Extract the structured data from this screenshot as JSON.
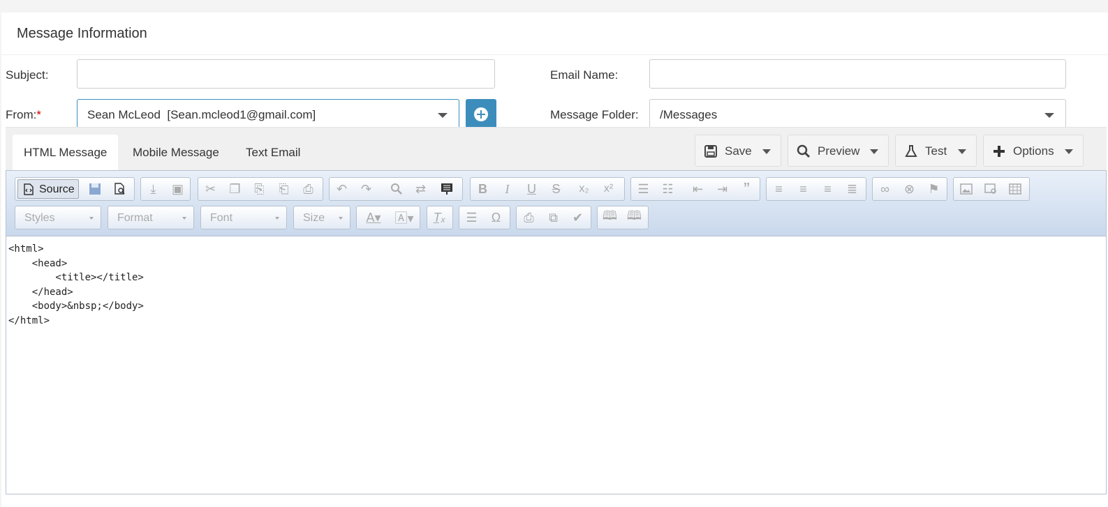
{
  "panel": {
    "title": "Message Information"
  },
  "form": {
    "subject": {
      "label": "Subject:",
      "value": ""
    },
    "email_name": {
      "label": "Email Name:",
      "value": ""
    },
    "from": {
      "label": "From:",
      "required_mark": "*",
      "value": "Sean McLeod  [Sean.mcleod1@gmail.com]"
    },
    "message_folder": {
      "label": "Message Folder:",
      "value": "/Messages"
    }
  },
  "tabs": [
    {
      "label": "HTML Message",
      "active": true
    },
    {
      "label": "Mobile Message",
      "active": false
    },
    {
      "label": "Text Email",
      "active": false
    }
  ],
  "actions": {
    "save": "Save",
    "preview": "Preview",
    "test": "Test",
    "options": "Options"
  },
  "editor": {
    "source_label": "Source",
    "combos": {
      "styles": "Styles",
      "format": "Format",
      "font": "Font",
      "size": "Size"
    },
    "content": "<html>\n    <head>\n        <title></title>\n    </head>\n    <body>&nbsp;</body>\n</html>"
  },
  "colors": {
    "accent": "#3c8dbc",
    "required": "#cc0000",
    "toolbar_top": "#e9f0f9",
    "toolbar_bottom": "#c9d8ec"
  }
}
